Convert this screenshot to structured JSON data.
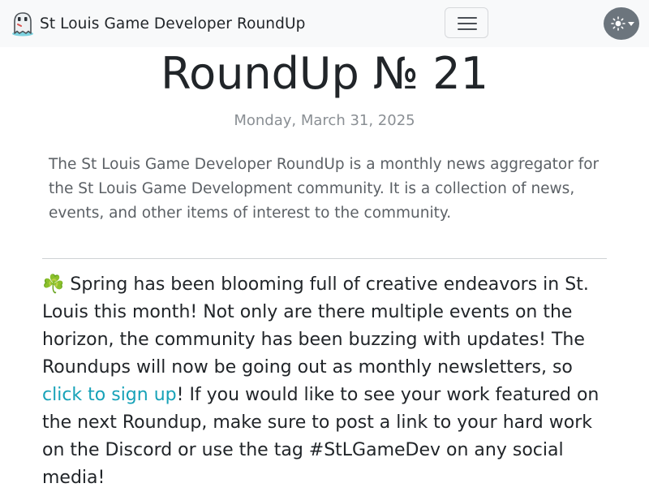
{
  "nav": {
    "brand": "St Louis Game Developer RoundUp",
    "menu_icon": "hamburger-icon",
    "theme_icon": "sun-icon"
  },
  "post": {
    "title": "RoundUp № 21",
    "date": "Monday, March 31, 2025",
    "intro": "The St Louis Game Developer RoundUp is a monthly news aggregator for the St Louis Game Development community. It is a collection of news, events, and other items of interest to the community.",
    "emoji": "☘️",
    "body_part1": " Spring has been blooming full of creative endeavors in St. Louis this month! Not only are there multiple events on the horizon, the community has been buzzing with updates! The Roundups will now be going out as monthly newsletters, so ",
    "link_text": "click to sign up",
    "body_part2": "! If you would like to see your work featured on the next Roundup, make sure to post a link to your hard work on the Discord or use the tag #StLGameDev on any social media!"
  },
  "colors": {
    "navbar_bg": "#f8f9fa",
    "link": "#17a2b8",
    "theme_button": "#6c757d",
    "muted_text": "#8a8f94"
  }
}
